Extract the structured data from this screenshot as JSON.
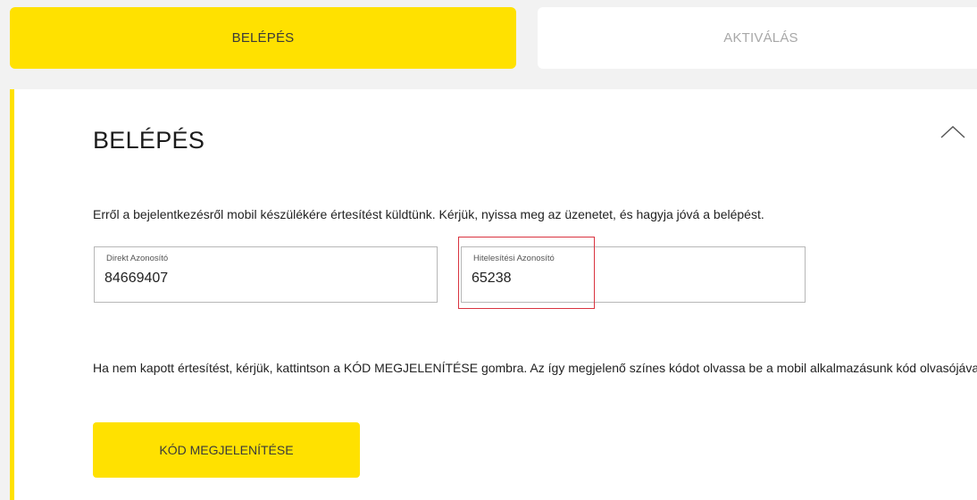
{
  "tabs": {
    "login": "BELÉPÉS",
    "activate": "AKTIVÁLÁS"
  },
  "panel": {
    "title": "BELÉPÉS",
    "collapse_icon": "chevron-up-icon",
    "info_text": "Erről a bejelentkezésről mobil készülékére értesítést küldtünk. Kérjük, nyissa meg az üzenetet, és hagyja jóvá a belépést.",
    "fields": {
      "direkt": {
        "label": "Direkt Azonosító",
        "value": "84669407"
      },
      "hitel": {
        "label": "Hitelesítési Azonosító",
        "value": "65238"
      }
    },
    "help_text": "Ha nem kapott értesítést, kérjük, kattintson a KÓD MEGJELENÍTÉSE gombra. Az így megjelenő színes kódot olvassa be a mobil alkalmazásunk kód olvasójával.",
    "show_code_button": "KÓD MEGJELENÍTÉSE"
  },
  "colors": {
    "accent": "#ffe100",
    "highlight": "#d9333f",
    "background": "#f2f2f2"
  }
}
